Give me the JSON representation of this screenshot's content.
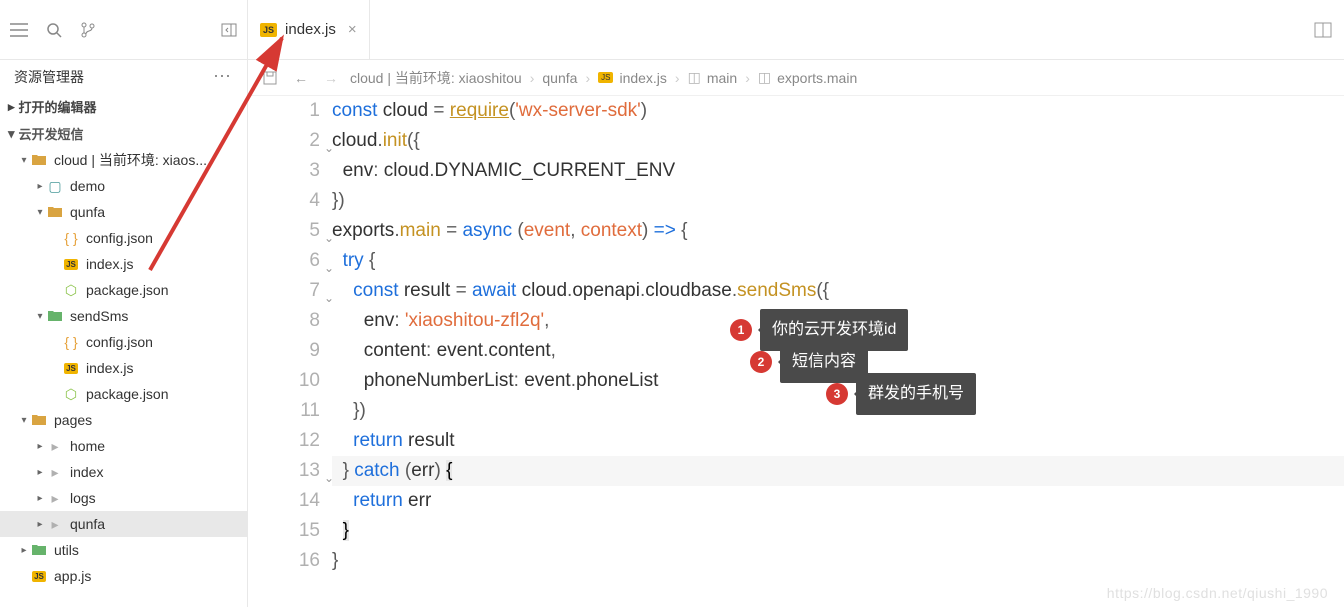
{
  "topbar": {},
  "tab": {
    "label": "index.js"
  },
  "sidebar": {
    "title": "资源管理器",
    "sectionOpened": "打开的编辑器",
    "sectionProject": "云开发短信",
    "items": [
      {
        "kind": "folder",
        "label": "cloud | 当前环境: xiaos...",
        "indent": 1,
        "caret": "▾",
        "color": "orange"
      },
      {
        "kind": "folder",
        "label": "demo",
        "indent": 2,
        "caret": "▸",
        "color": "teal"
      },
      {
        "kind": "folder",
        "label": "qunfa",
        "indent": 2,
        "caret": "▾",
        "color": "orange"
      },
      {
        "kind": "json",
        "label": "config.json",
        "indent": 3
      },
      {
        "kind": "js",
        "label": "index.js",
        "indent": 3
      },
      {
        "kind": "pkg",
        "label": "package.json",
        "indent": 3
      },
      {
        "kind": "folder",
        "label": "sendSms",
        "indent": 2,
        "caret": "▾",
        "color": "green"
      },
      {
        "kind": "json",
        "label": "config.json",
        "indent": 3
      },
      {
        "kind": "js",
        "label": "index.js",
        "indent": 3
      },
      {
        "kind": "pkg",
        "label": "package.json",
        "indent": 3
      },
      {
        "kind": "folder",
        "label": "pages",
        "indent": 1,
        "caret": "▾",
        "color": "orange"
      },
      {
        "kind": "folder",
        "label": "home",
        "indent": 2,
        "caret": "▸",
        "color": "gray"
      },
      {
        "kind": "folder",
        "label": "index",
        "indent": 2,
        "caret": "▸",
        "color": "gray"
      },
      {
        "kind": "folder",
        "label": "logs",
        "indent": 2,
        "caret": "▸",
        "color": "gray"
      },
      {
        "kind": "folder",
        "label": "qunfa",
        "indent": 2,
        "caret": "▸",
        "color": "gray",
        "selected": true
      },
      {
        "kind": "folder",
        "label": "utils",
        "indent": 1,
        "caret": "▸",
        "color": "green"
      },
      {
        "kind": "js",
        "label": "app.js",
        "indent": 1
      }
    ]
  },
  "breadcrumbs": {
    "items": [
      "cloud | 当前环境: xiaoshitou",
      "qunfa",
      "index.js",
      "main",
      "exports.main"
    ]
  },
  "code": {
    "lines": 16
  },
  "annot": [
    {
      "n": "1",
      "text": "你的云开发环境id"
    },
    {
      "n": "2",
      "text": "短信内容"
    },
    {
      "n": "3",
      "text": "群发的手机号"
    }
  ],
  "watermark": "https://blog.csdn.net/qiushi_1990"
}
